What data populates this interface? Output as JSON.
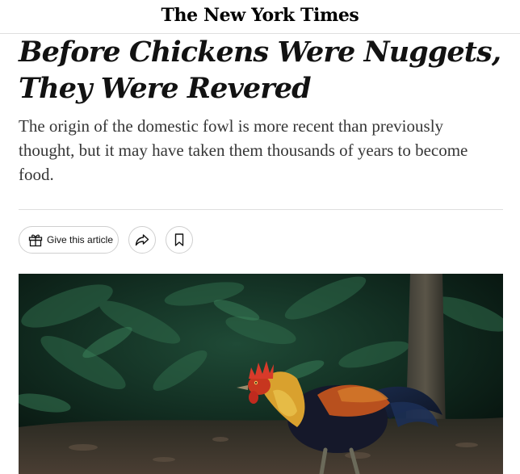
{
  "masthead": {
    "title": "The New York Times"
  },
  "article": {
    "headline": "Before Chickens Were Nuggets, They Were Revered",
    "summary": "The origin of the domestic fowl is more recent than previously thought, but it may have taken them thousands of years to become food."
  },
  "actions": {
    "gift_label": "Give this article",
    "gift_icon": "gift-icon",
    "share_icon": "share-arrow-icon",
    "save_icon": "bookmark-icon"
  },
  "lead_image": {
    "subject": "photo"
  },
  "colors": {
    "text": "#121212",
    "summary_text": "#363636",
    "divider": "#dfdfdf",
    "button_border": "#cfcfcf"
  }
}
